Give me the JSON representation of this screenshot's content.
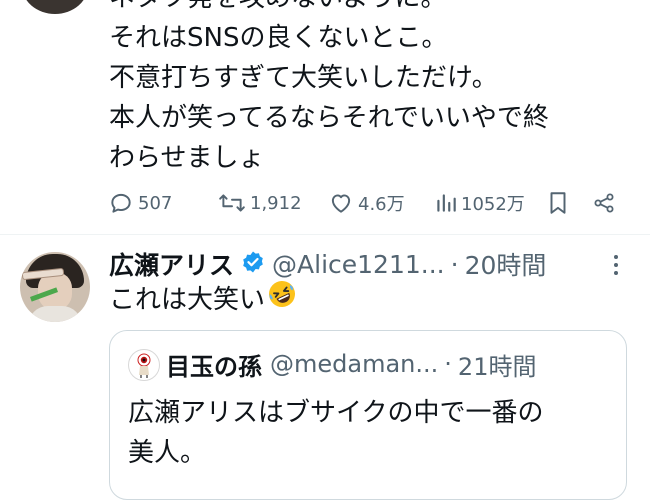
{
  "previous_tweet": {
    "lines": [
      "ネタツ発を攻めないように。",
      "それはSNSの良くないとこ。",
      "不意打ちすぎて大笑いしただけ。",
      "本人が笑ってるならそれでいいやで終",
      "わらせましょ"
    ],
    "actions": {
      "replies": "507",
      "retweets": "1,912",
      "likes": "4.6万",
      "views": "1052万"
    }
  },
  "tweet": {
    "name": "広瀬アリス",
    "handle": "@Alice1211...",
    "separator": "·",
    "time": "20時間",
    "text": "これは大笑い",
    "emoji": "rolling-on-floor-laughing-emoji"
  },
  "quoted_tweet": {
    "name": "目玉の孫",
    "handle": "@medaman...",
    "separator": "·",
    "time": "21時間",
    "lines": [
      "広瀬アリスはブサイクの中で一番の",
      "美人。"
    ]
  },
  "colors": {
    "text": "#0f1419",
    "secondary": "#536471",
    "verified": "#1d9bf0",
    "border": "#cfd9de"
  }
}
